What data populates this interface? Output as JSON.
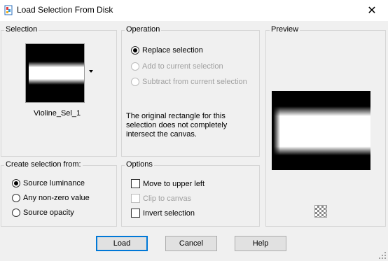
{
  "window": {
    "title": "Load Selection From Disk",
    "close_glyph": "✕"
  },
  "selection": {
    "title": "Selection",
    "name": "Violine_Sel_1"
  },
  "operation": {
    "title": "Operation",
    "options": [
      {
        "label": "Replace selection",
        "selected": true,
        "enabled": true
      },
      {
        "label": "Add to current selection",
        "selected": false,
        "enabled": false
      },
      {
        "label": "Subtract from current selection",
        "selected": false,
        "enabled": false
      }
    ],
    "message": "The original rectangle for this selection does not completely intersect the canvas."
  },
  "preview": {
    "title": "Preview"
  },
  "create_from": {
    "title": "Create selection from:",
    "options": [
      {
        "label": "Source luminance",
        "selected": true
      },
      {
        "label": "Any non-zero value",
        "selected": false
      },
      {
        "label": "Source opacity",
        "selected": false
      }
    ]
  },
  "options": {
    "title": "Options",
    "items": [
      {
        "label": "Move to upper left",
        "checked": false,
        "enabled": true
      },
      {
        "label": "Clip to canvas",
        "checked": false,
        "enabled": false
      },
      {
        "label": "Invert selection",
        "checked": false,
        "enabled": true
      }
    ]
  },
  "buttons": {
    "load": "Load",
    "cancel": "Cancel",
    "help": "Help"
  },
  "colors": {
    "default_button_border": "#0078d7",
    "dialog_bg": "#f0f0f0"
  }
}
